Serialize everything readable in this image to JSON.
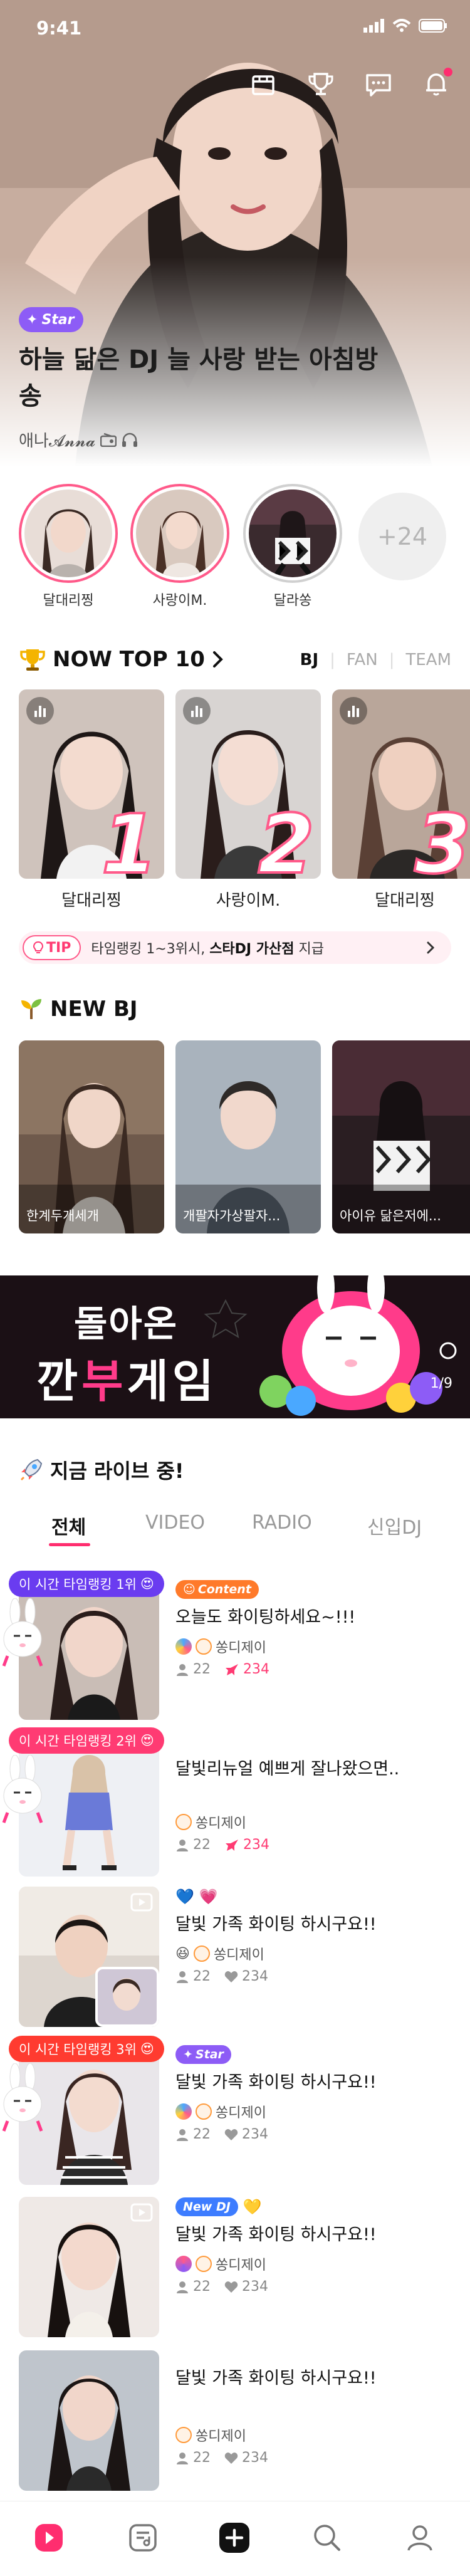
{
  "status_bar": {
    "time": "9:41"
  },
  "hero": {
    "badge_label": "Star",
    "title": "하늘 닮은 DJ 늘 사랑 받는 아침방송",
    "dj_name": "애나𝓐𝓷𝓷𝓪",
    "top_icons": [
      "store-icon",
      "trophy-icon",
      "chat-icon",
      "bell-icon"
    ]
  },
  "following": {
    "items": [
      {
        "name": "달대리찡"
      },
      {
        "name": "사랑이M."
      },
      {
        "name": "달라쏭"
      }
    ],
    "more_label": "+24"
  },
  "top10": {
    "title": "NOW TOP 10",
    "tabs": [
      "BJ",
      "FAN",
      "TEAM"
    ],
    "active_tab": "BJ",
    "items": [
      {
        "rank": "1",
        "name": "달대리찡"
      },
      {
        "rank": "2",
        "name": "사랑이M."
      },
      {
        "rank": "3",
        "name": "달대리찡"
      }
    ],
    "tip_label": "TIP",
    "tip_text_prefix": "타임랭킹 1~3위시,",
    "tip_text_bold": "스타DJ 가산점",
    "tip_text_suffix": "지급"
  },
  "newbj": {
    "title": "NEW BJ",
    "items": [
      {
        "name": "한계두개세개"
      },
      {
        "name": "개팔자가상팔자..."
      },
      {
        "name": "아이유 닮은저에..."
      }
    ]
  },
  "banner": {
    "line1": "돌아온",
    "line2a": "깐",
    "line2b": "부",
    "line2c": "게임",
    "counter": "1/9"
  },
  "live": {
    "title": "지금 라이브 중!",
    "tabs": [
      "전체",
      "VIDEO",
      "RADIO",
      "신입DJ"
    ],
    "active_tab": "전체",
    "items": [
      {
        "rank_tag": "이 시간 타임랭킹 1위",
        "tags": [
          "Content"
        ],
        "title": "오늘도 화이팅하세요~!!!",
        "dj": "쏭디제이",
        "viewers": "22",
        "likes": "234"
      },
      {
        "rank_tag": "이 시간 타임랭킹 2위",
        "tags": [],
        "title": "달빛리뉴얼 예쁘게 잘나왔으면..",
        "dj": "쏭디제이",
        "viewers": "22",
        "likes": "234"
      },
      {
        "rank_tag": "",
        "tags": [],
        "title": "달빛 가족 화이팅 하시구요!!",
        "dj": "쏭디제이",
        "viewers": "22",
        "likes": "234"
      },
      {
        "rank_tag": "이 시간 타임랭킹 3위",
        "tags": [
          "Star"
        ],
        "title": "달빛 가족 화이팅 하시구요!!",
        "dj": "쏭디제이",
        "viewers": "22",
        "likes": "234"
      },
      {
        "rank_tag": "",
        "tags": [
          "New DJ"
        ],
        "title": "달빛 가족 화이팅 하시구요!!",
        "dj": "쏭디제이",
        "viewers": "22",
        "likes": "234"
      },
      {
        "rank_tag": "",
        "tags": [],
        "title": "달빛 가족 화이팅 하시구요!!",
        "dj": "쏭디제이",
        "viewers": "22",
        "likes": "234"
      }
    ]
  },
  "bottom_nav": [
    "home-icon",
    "playlist-icon",
    "create-icon",
    "search-icon",
    "profile-icon"
  ],
  "colors": {
    "accent": "#ff2d6f",
    "purple": "#6a3cf0",
    "star": "#8d5cf6"
  }
}
